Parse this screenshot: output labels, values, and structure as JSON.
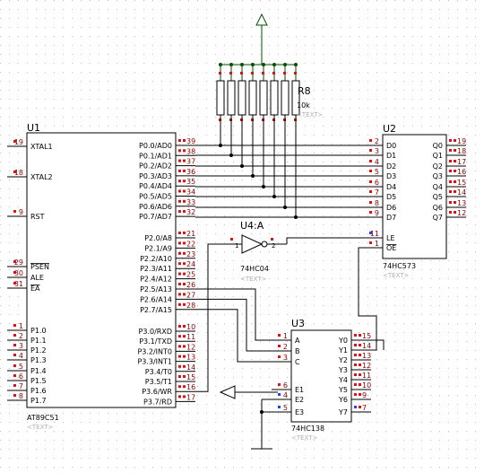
{
  "u1": {
    "ref": "U1",
    "part": "AT89C51",
    "text": "<TEXT>",
    "left_pins": [
      {
        "num": "19",
        "name": "XTAL1"
      },
      {
        "num": "18",
        "name": "XTAL2"
      },
      {
        "num": "9",
        "name": "RST"
      },
      {
        "num": "29",
        "name": "PSEN"
      },
      {
        "num": "30",
        "name": "ALE"
      },
      {
        "num": "31",
        "name": "EA"
      },
      {
        "num": "1",
        "name": "P1.0"
      },
      {
        "num": "2",
        "name": "P1.1"
      },
      {
        "num": "3",
        "name": "P1.2"
      },
      {
        "num": "4",
        "name": "P1.3"
      },
      {
        "num": "5",
        "name": "P1.4"
      },
      {
        "num": "6",
        "name": "P1.5"
      },
      {
        "num": "7",
        "name": "P1.6"
      },
      {
        "num": "8",
        "name": "P1.7"
      }
    ],
    "right_pins": [
      {
        "num": "39",
        "name": "P0.0/AD0"
      },
      {
        "num": "38",
        "name": "P0.1/AD1"
      },
      {
        "num": "37",
        "name": "P0.2/AD2"
      },
      {
        "num": "36",
        "name": "P0.3/AD3"
      },
      {
        "num": "35",
        "name": "P0.4/AD4"
      },
      {
        "num": "34",
        "name": "P0.5/AD5"
      },
      {
        "num": "33",
        "name": "P0.6/AD6"
      },
      {
        "num": "32",
        "name": "P0.7/AD7"
      },
      {
        "num": "21",
        "name": "P2.0/A8"
      },
      {
        "num": "22",
        "name": "P2.1/A9"
      },
      {
        "num": "23",
        "name": "P2.2/A10"
      },
      {
        "num": "24",
        "name": "P2.3/A11"
      },
      {
        "num": "25",
        "name": "P2.4/A12"
      },
      {
        "num": "26",
        "name": "P2.5/A13"
      },
      {
        "num": "27",
        "name": "P2.6/A14"
      },
      {
        "num": "28",
        "name": "P2.7/A15"
      },
      {
        "num": "10",
        "name": "P3.0/RXD"
      },
      {
        "num": "11",
        "name": "P3.1/TXD"
      },
      {
        "num": "12",
        "name": "P3.2/INT0"
      },
      {
        "num": "13",
        "name": "P3.3/INT1"
      },
      {
        "num": "14",
        "name": "P3.4/T0"
      },
      {
        "num": "15",
        "name": "P3.5/T1"
      },
      {
        "num": "16",
        "name": "P3.6/WR"
      },
      {
        "num": "17",
        "name": "P3.7/RD"
      }
    ]
  },
  "u2": {
    "ref": "U2",
    "part": "74HC573",
    "text": "<TEXT>",
    "left_pins": [
      {
        "num": "2",
        "name": "D0"
      },
      {
        "num": "3",
        "name": "D1"
      },
      {
        "num": "4",
        "name": "D2"
      },
      {
        "num": "5",
        "name": "D3"
      },
      {
        "num": "6",
        "name": "D4"
      },
      {
        "num": "7",
        "name": "D5"
      },
      {
        "num": "8",
        "name": "D6"
      },
      {
        "num": "9",
        "name": "D7"
      },
      {
        "num": "11",
        "name": "LE"
      },
      {
        "num": "1",
        "name": "OE"
      }
    ],
    "right_pins": [
      {
        "num": "19",
        "name": "Q0"
      },
      {
        "num": "18",
        "name": "Q1"
      },
      {
        "num": "17",
        "name": "Q2"
      },
      {
        "num": "16",
        "name": "Q3"
      },
      {
        "num": "15",
        "name": "Q4"
      },
      {
        "num": "14",
        "name": "Q5"
      },
      {
        "num": "13",
        "name": "Q6"
      },
      {
        "num": "12",
        "name": "Q7"
      }
    ]
  },
  "u3": {
    "ref": "U3",
    "part": "74HC138",
    "text": "<TEXT>",
    "left_pins": [
      {
        "num": "1",
        "name": "A"
      },
      {
        "num": "2",
        "name": "B"
      },
      {
        "num": "3",
        "name": "C"
      },
      {
        "num": "6",
        "name": "E1"
      },
      {
        "num": "4",
        "name": "E2"
      },
      {
        "num": "5",
        "name": "E3"
      }
    ],
    "right_pins": [
      {
        "num": "15",
        "name": "Y0"
      },
      {
        "num": "14",
        "name": "Y1"
      },
      {
        "num": "13",
        "name": "Y2"
      },
      {
        "num": "12",
        "name": "Y3"
      },
      {
        "num": "11",
        "name": "Y4"
      },
      {
        "num": "10",
        "name": "Y5"
      },
      {
        "num": "9",
        "name": "Y6"
      },
      {
        "num": "7",
        "name": "Y7"
      }
    ]
  },
  "u4": {
    "ref": "U4:A",
    "part": "74HC04",
    "text": "<TEXT>",
    "pin_in": "1",
    "pin_out": "2"
  },
  "rp": {
    "ref": "R8",
    "value": "10k",
    "text": "<TEXT>"
  },
  "colors": {
    "wire": "#000000",
    "pin_red": "#e01010",
    "pin_blue": "#2040ff",
    "grid_dot": "#c0c0c0",
    "power_wire": "#005000"
  },
  "symbols": {
    "power": "power-arrow",
    "ground": "ground-symbol",
    "generator": "generator-triangle"
  }
}
